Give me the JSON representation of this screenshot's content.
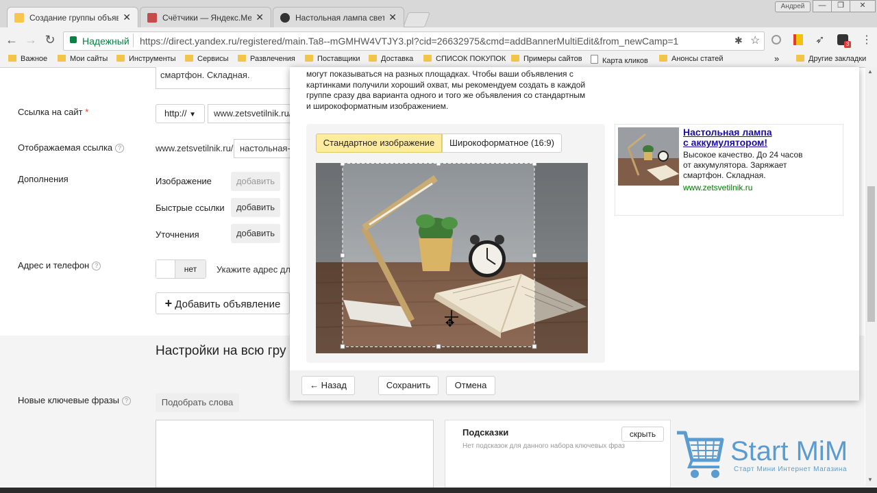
{
  "browser": {
    "tabs": [
      {
        "title": "Создание группы объявле",
        "active": true,
        "color": "#f7c64a"
      },
      {
        "title": "Счётчики — Яндекс.Метри",
        "active": false,
        "color": "#c94a4a"
      },
      {
        "title": "Настольная лампа светод",
        "active": false,
        "color": "#333333"
      }
    ],
    "user_badge": "Андрей",
    "secure_label": "Надежный",
    "url": "https://direct.yandex.ru/registered/main.Ta8--mGMHW4VTJY3.pl?cid=26632975&cmd=addBannerMultiEdit&from_newCamp=1",
    "bookmarks": [
      "Важное",
      "Мои сайты",
      "Инструменты",
      "Сервисы",
      "Развлечения",
      "Поставщики",
      "Доставка",
      "СПИСОК ПОКУПОК",
      "Примеры сайтов",
      "Карта кликов",
      "Анонсы статей"
    ],
    "bookmarks_more": "»",
    "other_bookmarks": "Другие закладки"
  },
  "form": {
    "text_tail": "смартфон. Складная.",
    "site_link_label": "Ссылка на сайт",
    "required_mark": "*",
    "protocol": "http://",
    "site_url": "www.zetsvetilnik.ru/",
    "display_link_label": "Отображаемая ссылка",
    "display_domain": "www.zetsvetilnik.ru/",
    "display_path": "настольная-",
    "extras_label": "Дополнения",
    "image_label": "Изображение",
    "quick_links_label": "Быстрые ссылки",
    "clarifications_label": "Уточнения",
    "add_label": "добавить",
    "address_label": "Адрес и телефон",
    "toggle_off": "нет",
    "address_hint": "Укажите адрес дл",
    "add_ad_button": "Добавить объявление",
    "group_settings_title": "Настройки на всю гру",
    "keywords_label": "Новые ключевые фразы",
    "pick_words": "Подобрать слова",
    "hints_title": "Подсказки",
    "hide_button": "скрыть",
    "no_hints": "Нет подсказок для данного набора ключевых фраз"
  },
  "modal": {
    "description": [
      "могут показываться на разных площадках. Чтобы ваши объявления с",
      "картинками получили хороший охват, мы рекомендуем создать в каждой",
      "группе сразу два варианта одного и того же объявления со стандартным",
      "и широкоформатным изображением."
    ],
    "tab_standard": "Стандартное изображение",
    "tab_wide": "Широкоформатное (16:9)",
    "back_button": "← Назад",
    "save_button": "Сохранить",
    "cancel_button": "Отмена",
    "preview": {
      "title_line1": "Настольная лампа",
      "title_line2": "с аккумулятором!",
      "body": [
        "Высокое качество. До 24 часов",
        "от аккумулятора. Заряжает",
        "смартфон. Складная."
      ],
      "domain": "www.zetsvetilnik.ru"
    }
  },
  "watermark": {
    "brand": "StartMiM",
    "brand_a": "Start",
    "brand_b": "MiM",
    "tagline": "Старт Мини Интернет Магазина",
    "color": "#5a9ccf"
  }
}
